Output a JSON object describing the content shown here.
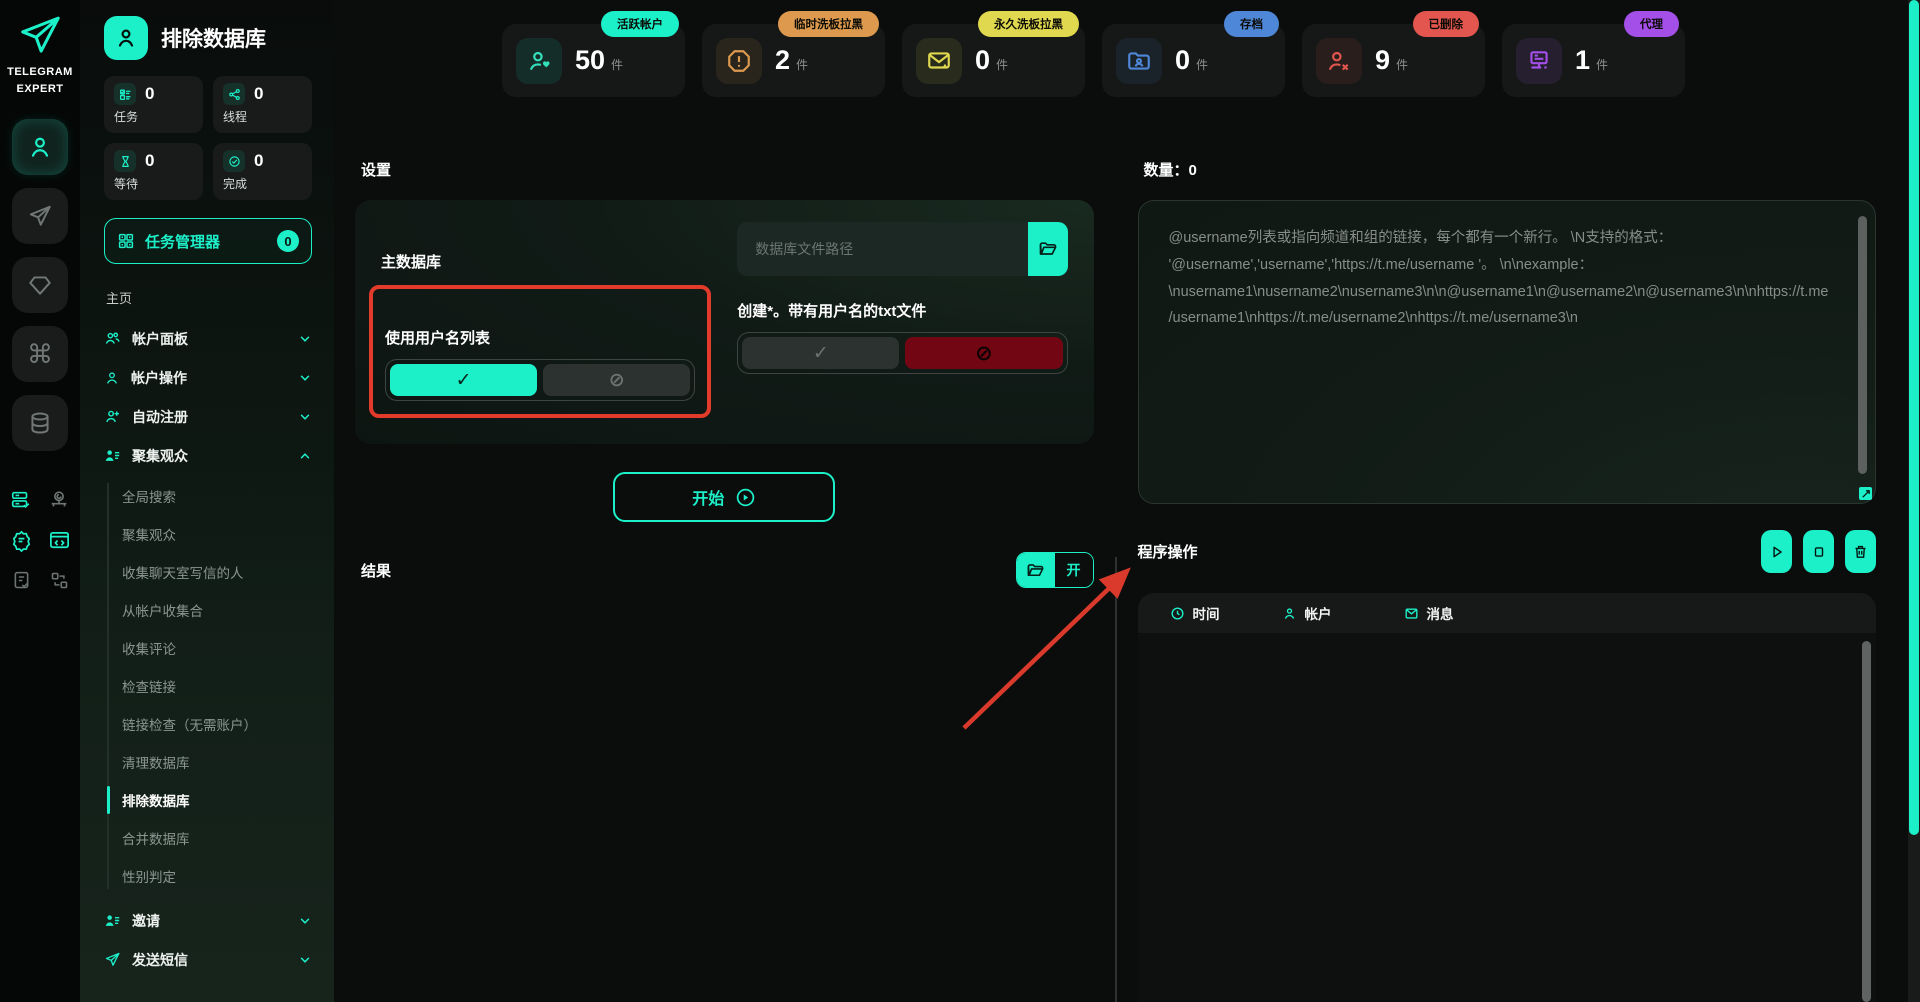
{
  "brand": {
    "line1": "TELEGRAM",
    "line2": "EXPERT"
  },
  "colors": {
    "accent": "#1cf0c9",
    "highlight_box": "#e23b2c",
    "arrow": "#d93a2c"
  },
  "rail": {
    "icons": [
      "user-icon",
      "send-icon",
      "diamond-icon",
      "command-icon",
      "database-icon"
    ],
    "command_glyph": "⌘",
    "footer_icons": [
      "server-check-icon",
      "user-network-icon",
      "gear-chat-icon",
      "browser-code-icon",
      "document-check-icon",
      "swap-icon"
    ]
  },
  "sidebar": {
    "title": "排除数据库",
    "mini_stats": [
      {
        "label": "任务",
        "value": "0",
        "icon": "tasks-icon"
      },
      {
        "label": "线程",
        "value": "0",
        "icon": "threads-icon"
      },
      {
        "label": "等待",
        "value": "0",
        "icon": "hourglass-icon"
      },
      {
        "label": "完成",
        "value": "0",
        "icon": "check-circle-icon"
      }
    ],
    "task_manager": {
      "label": "任务管理器",
      "badge": "0"
    },
    "home": "主页",
    "groups": [
      {
        "label": "帐户面板",
        "icon": "users-icon"
      },
      {
        "label": "帐户操作",
        "icon": "user-icon"
      },
      {
        "label": "自动注册",
        "icon": "user-plus-icon"
      },
      {
        "label": "聚集观众",
        "icon": "user-list-icon",
        "expanded": true
      },
      {
        "label": "邀请",
        "icon": "user-list-icon"
      },
      {
        "label": "发送短信",
        "icon": "send-icon"
      }
    ],
    "submenu": [
      "全局搜索",
      "聚集观众",
      "收集聊天室写信的人",
      "从帐户收集合",
      "收集评论",
      "检查链接",
      "链接检查（无需账户）",
      "清理数据库",
      "排除数据库",
      "合并数据库",
      "性别判定"
    ],
    "active_item": "排除数据库"
  },
  "top_stats": [
    {
      "badge": "活跃帐户",
      "value": "50",
      "unit": "件",
      "color": "#1cf0c9",
      "icon": "user-heart-icon"
    },
    {
      "badge": "临时洗板拉黑",
      "value": "2",
      "unit": "件",
      "color": "#dd9a4e",
      "icon": "warning-octagon-icon"
    },
    {
      "badge": "永久洗板拉黑",
      "value": "0",
      "unit": "件",
      "color": "#e0d84f",
      "icon": "mail-warning-icon"
    },
    {
      "badge": "存档",
      "value": "0",
      "unit": "件",
      "color": "#4f87d8",
      "icon": "folder-user-icon"
    },
    {
      "badge": "已删除",
      "value": "9",
      "unit": "件",
      "color": "#e2564f",
      "icon": "user-x-icon"
    },
    {
      "badge": "代理",
      "value": "1",
      "unit": "件",
      "color": "#a44fe8",
      "icon": "proxy-server-icon"
    }
  ],
  "settings": {
    "section_title": "设置",
    "main_db_label": "主数据库",
    "use_username_list_label": "使用用户名列表",
    "db_path_placeholder": "数据库文件路径",
    "create_txt_label": "创建*。带有用户名的txt文件",
    "check_glyph": "✓",
    "prohibit_glyph": "⊘",
    "start_label": "开始"
  },
  "results": {
    "section_title": "结果",
    "open_label": "开"
  },
  "right_panel": {
    "quantity_label": "数量：0",
    "textarea_placeholder": "@username列表或指向频道和组的链接，每个都有一个新行。 \\N支持的格式： '@username','username','https://t.me/username '。 \\n\\nexample： \\nusername1\\nusername2\\nusername3\\n\\n@username1\\n@username2\\n@username3\\n\\nhttps://t.me/username1\\nhttps://t.me/username2\\nhttps://t.me/username3\\n",
    "program_ops_label": "程序操作",
    "ops_buttons": [
      "play-icon",
      "stop-icon",
      "trash-icon"
    ],
    "table_headers": [
      {
        "label": "时间",
        "icon": "clock-icon"
      },
      {
        "label": "帐户",
        "icon": "user-icon"
      },
      {
        "label": "消息",
        "icon": "mail-icon"
      }
    ]
  }
}
